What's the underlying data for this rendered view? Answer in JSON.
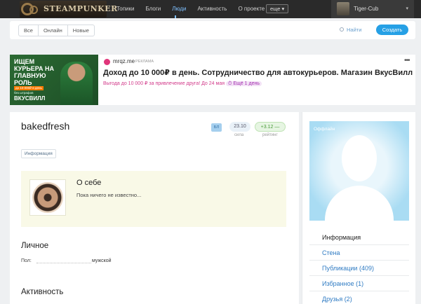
{
  "topnav": {
    "logo_text": "STEAMPUNKER",
    "items": [
      {
        "label": "Топики",
        "active": false
      },
      {
        "label": "Блоги",
        "active": false
      },
      {
        "label": "Люди",
        "active": true
      },
      {
        "label": "Активность",
        "active": false
      },
      {
        "label": "О проекте",
        "active": false
      }
    ],
    "more_label": "еще ▾",
    "user_name": "Tiger-Cub",
    "user_caret": "▾"
  },
  "filterbar": {
    "segments": [
      "Все",
      "Онлайн",
      "Новые"
    ],
    "find_label": "Найти",
    "create_label": "Создать"
  },
  "ad": {
    "banner_line1": "ИЩЕМ КУРЬЕРА НА ГЛАВНУЮ РОЛЬ",
    "banner_line2": "до 10 000₽ в день",
    "banner_line3": "без штрафов",
    "banner_brand": "ВКУСВИЛЛ",
    "domain": "mrqz.me",
    "tag": "РЕКЛАМА",
    "menu": "•••",
    "title": "Доход до 10 000₽ в день. Сотрудничество для автокурьеров. Магазин ВкусВилл",
    "subtitle": "Выгода до 10 000 ₽ за привлечение друга! До 24 мая",
    "subtitle_pill": "Ещё 1 день"
  },
  "profile": {
    "username": "bakedfresh",
    "badge": "БЛ",
    "power_value": "23.10",
    "power_label": "сила",
    "rating_value": "+3.12 —",
    "rating_label": "рейтинг",
    "info_tab": "Информация",
    "about_title": "О себе",
    "about_text": "Пока ничего не известно...",
    "personal_title": "Личное",
    "gender_label": "Пол:",
    "gender_value": "мужской",
    "activity_title": "Активность"
  },
  "sidebar": {
    "status": "Оффлайн",
    "menu": [
      {
        "label": "Информация",
        "is_head": true
      },
      {
        "label": "Стена",
        "is_head": false
      },
      {
        "label": "Публикации (409)",
        "is_head": false
      },
      {
        "label": "Избранное (1)",
        "is_head": false
      },
      {
        "label": "Друзья (2)",
        "is_head": false
      }
    ]
  },
  "colors": {
    "accent": "#26a0e5",
    "nav_active": "#7fc0ff",
    "link": "#2f7bc3",
    "about_bg": "#f9f9e7",
    "ad_pink": "#d23a8a"
  }
}
